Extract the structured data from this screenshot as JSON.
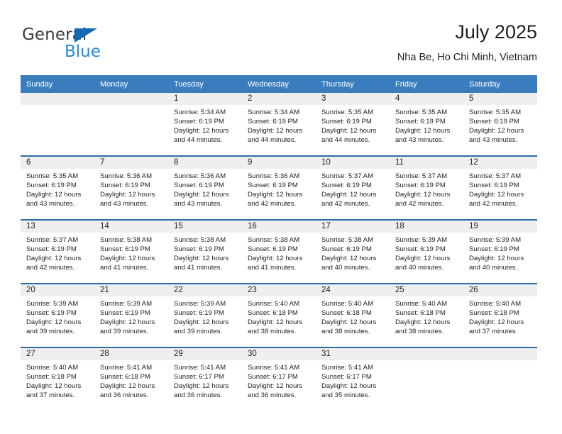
{
  "logo": {
    "word_top": "General",
    "word_bottom": "Blue",
    "triangle_color": "#1268b3",
    "blue_color": "#2389d4"
  },
  "header": {
    "title": "July 2025",
    "location": "Nha Be, Ho Chi Minh, Vietnam"
  },
  "theme": {
    "header_blue": "#3a7dbf",
    "row_divider_blue": "#2c6da8",
    "daynum_band": "#efefef",
    "text": "#231f20"
  },
  "weekdays": [
    "Sunday",
    "Monday",
    "Tuesday",
    "Wednesday",
    "Thursday",
    "Friday",
    "Saturday"
  ],
  "labels": {
    "sunrise": "Sunrise:",
    "sunset": "Sunset:",
    "daylight": "Daylight:"
  },
  "weeks": [
    [
      {
        "day": "",
        "sunrise": "",
        "sunset": "",
        "daylight_1": "",
        "daylight_2": ""
      },
      {
        "day": "",
        "sunrise": "",
        "sunset": "",
        "daylight_1": "",
        "daylight_2": ""
      },
      {
        "day": "1",
        "sunrise": "Sunrise: 5:34 AM",
        "sunset": "Sunset: 6:19 PM",
        "daylight_1": "Daylight: 12 hours",
        "daylight_2": "and 44 minutes."
      },
      {
        "day": "2",
        "sunrise": "Sunrise: 5:34 AM",
        "sunset": "Sunset: 6:19 PM",
        "daylight_1": "Daylight: 12 hours",
        "daylight_2": "and 44 minutes."
      },
      {
        "day": "3",
        "sunrise": "Sunrise: 5:35 AM",
        "sunset": "Sunset: 6:19 PM",
        "daylight_1": "Daylight: 12 hours",
        "daylight_2": "and 44 minutes."
      },
      {
        "day": "4",
        "sunrise": "Sunrise: 5:35 AM",
        "sunset": "Sunset: 6:19 PM",
        "daylight_1": "Daylight: 12 hours",
        "daylight_2": "and 43 minutes."
      },
      {
        "day": "5",
        "sunrise": "Sunrise: 5:35 AM",
        "sunset": "Sunset: 6:19 PM",
        "daylight_1": "Daylight: 12 hours",
        "daylight_2": "and 43 minutes."
      }
    ],
    [
      {
        "day": "6",
        "sunrise": "Sunrise: 5:35 AM",
        "sunset": "Sunset: 6:19 PM",
        "daylight_1": "Daylight: 12 hours",
        "daylight_2": "and 43 minutes."
      },
      {
        "day": "7",
        "sunrise": "Sunrise: 5:36 AM",
        "sunset": "Sunset: 6:19 PM",
        "daylight_1": "Daylight: 12 hours",
        "daylight_2": "and 43 minutes."
      },
      {
        "day": "8",
        "sunrise": "Sunrise: 5:36 AM",
        "sunset": "Sunset: 6:19 PM",
        "daylight_1": "Daylight: 12 hours",
        "daylight_2": "and 43 minutes."
      },
      {
        "day": "9",
        "sunrise": "Sunrise: 5:36 AM",
        "sunset": "Sunset: 6:19 PM",
        "daylight_1": "Daylight: 12 hours",
        "daylight_2": "and 42 minutes."
      },
      {
        "day": "10",
        "sunrise": "Sunrise: 5:37 AM",
        "sunset": "Sunset: 6:19 PM",
        "daylight_1": "Daylight: 12 hours",
        "daylight_2": "and 42 minutes."
      },
      {
        "day": "11",
        "sunrise": "Sunrise: 5:37 AM",
        "sunset": "Sunset: 6:19 PM",
        "daylight_1": "Daylight: 12 hours",
        "daylight_2": "and 42 minutes."
      },
      {
        "day": "12",
        "sunrise": "Sunrise: 5:37 AM",
        "sunset": "Sunset: 6:19 PM",
        "daylight_1": "Daylight: 12 hours",
        "daylight_2": "and 42 minutes."
      }
    ],
    [
      {
        "day": "13",
        "sunrise": "Sunrise: 5:37 AM",
        "sunset": "Sunset: 6:19 PM",
        "daylight_1": "Daylight: 12 hours",
        "daylight_2": "and 42 minutes."
      },
      {
        "day": "14",
        "sunrise": "Sunrise: 5:38 AM",
        "sunset": "Sunset: 6:19 PM",
        "daylight_1": "Daylight: 12 hours",
        "daylight_2": "and 41 minutes."
      },
      {
        "day": "15",
        "sunrise": "Sunrise: 5:38 AM",
        "sunset": "Sunset: 6:19 PM",
        "daylight_1": "Daylight: 12 hours",
        "daylight_2": "and 41 minutes."
      },
      {
        "day": "16",
        "sunrise": "Sunrise: 5:38 AM",
        "sunset": "Sunset: 6:19 PM",
        "daylight_1": "Daylight: 12 hours",
        "daylight_2": "and 41 minutes."
      },
      {
        "day": "17",
        "sunrise": "Sunrise: 5:38 AM",
        "sunset": "Sunset: 6:19 PM",
        "daylight_1": "Daylight: 12 hours",
        "daylight_2": "and 40 minutes."
      },
      {
        "day": "18",
        "sunrise": "Sunrise: 5:39 AM",
        "sunset": "Sunset: 6:19 PM",
        "daylight_1": "Daylight: 12 hours",
        "daylight_2": "and 40 minutes."
      },
      {
        "day": "19",
        "sunrise": "Sunrise: 5:39 AM",
        "sunset": "Sunset: 6:19 PM",
        "daylight_1": "Daylight: 12 hours",
        "daylight_2": "and 40 minutes."
      }
    ],
    [
      {
        "day": "20",
        "sunrise": "Sunrise: 5:39 AM",
        "sunset": "Sunset: 6:19 PM",
        "daylight_1": "Daylight: 12 hours",
        "daylight_2": "and 39 minutes."
      },
      {
        "day": "21",
        "sunrise": "Sunrise: 5:39 AM",
        "sunset": "Sunset: 6:19 PM",
        "daylight_1": "Daylight: 12 hours",
        "daylight_2": "and 39 minutes."
      },
      {
        "day": "22",
        "sunrise": "Sunrise: 5:39 AM",
        "sunset": "Sunset: 6:19 PM",
        "daylight_1": "Daylight: 12 hours",
        "daylight_2": "and 39 minutes."
      },
      {
        "day": "23",
        "sunrise": "Sunrise: 5:40 AM",
        "sunset": "Sunset: 6:18 PM",
        "daylight_1": "Daylight: 12 hours",
        "daylight_2": "and 38 minutes."
      },
      {
        "day": "24",
        "sunrise": "Sunrise: 5:40 AM",
        "sunset": "Sunset: 6:18 PM",
        "daylight_1": "Daylight: 12 hours",
        "daylight_2": "and 38 minutes."
      },
      {
        "day": "25",
        "sunrise": "Sunrise: 5:40 AM",
        "sunset": "Sunset: 6:18 PM",
        "daylight_1": "Daylight: 12 hours",
        "daylight_2": "and 38 minutes."
      },
      {
        "day": "26",
        "sunrise": "Sunrise: 5:40 AM",
        "sunset": "Sunset: 6:18 PM",
        "daylight_1": "Daylight: 12 hours",
        "daylight_2": "and 37 minutes."
      }
    ],
    [
      {
        "day": "27",
        "sunrise": "Sunrise: 5:40 AM",
        "sunset": "Sunset: 6:18 PM",
        "daylight_1": "Daylight: 12 hours",
        "daylight_2": "and 37 minutes."
      },
      {
        "day": "28",
        "sunrise": "Sunrise: 5:41 AM",
        "sunset": "Sunset: 6:18 PM",
        "daylight_1": "Daylight: 12 hours",
        "daylight_2": "and 36 minutes."
      },
      {
        "day": "29",
        "sunrise": "Sunrise: 5:41 AM",
        "sunset": "Sunset: 6:17 PM",
        "daylight_1": "Daylight: 12 hours",
        "daylight_2": "and 36 minutes."
      },
      {
        "day": "30",
        "sunrise": "Sunrise: 5:41 AM",
        "sunset": "Sunset: 6:17 PM",
        "daylight_1": "Daylight: 12 hours",
        "daylight_2": "and 36 minutes."
      },
      {
        "day": "31",
        "sunrise": "Sunrise: 5:41 AM",
        "sunset": "Sunset: 6:17 PM",
        "daylight_1": "Daylight: 12 hours",
        "daylight_2": "and 35 minutes."
      },
      {
        "day": "",
        "sunrise": "",
        "sunset": "",
        "daylight_1": "",
        "daylight_2": ""
      },
      {
        "day": "",
        "sunrise": "",
        "sunset": "",
        "daylight_1": "",
        "daylight_2": ""
      }
    ]
  ]
}
